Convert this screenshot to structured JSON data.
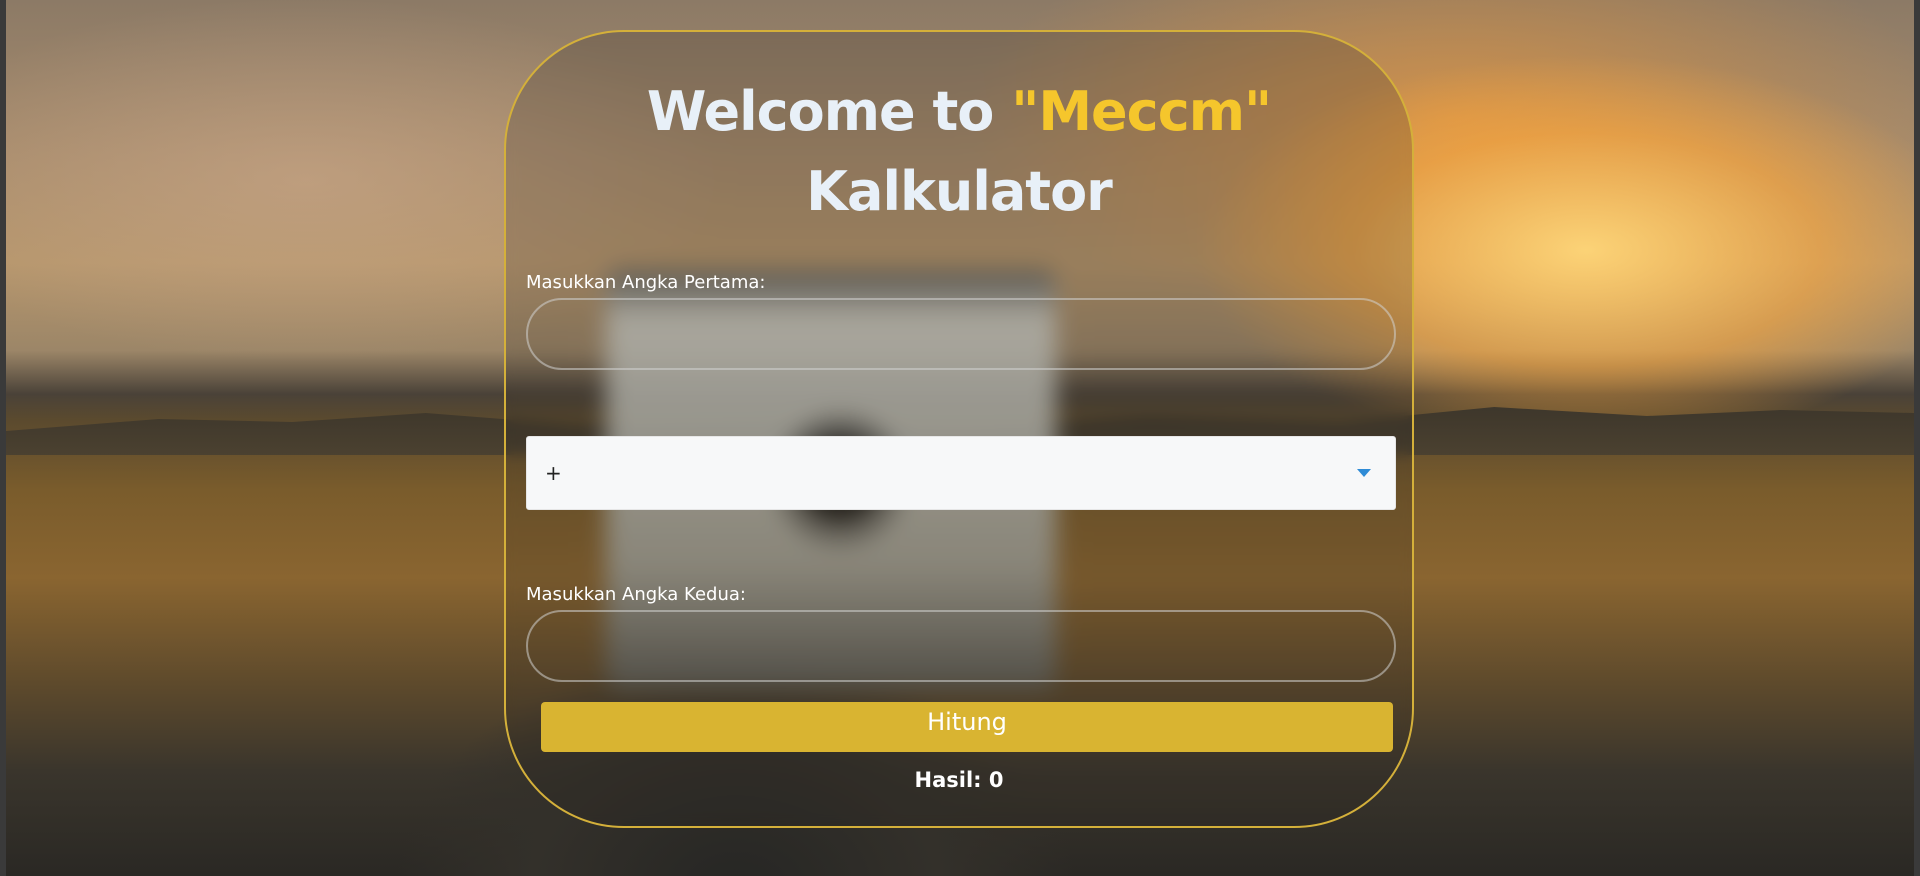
{
  "header": {
    "title_prefix": "Welcome to ",
    "title_brand": "\"Meccm\"",
    "title_suffix": "Kalkulator"
  },
  "form": {
    "first_label": "Masukkan Angka Pertama:",
    "first_value": "",
    "operator_value": "+",
    "second_label": "Masukkan Angka Kedua:",
    "second_value": "",
    "submit_label": "Hitung"
  },
  "result": {
    "text": "Hasil: 0"
  },
  "colors": {
    "accent": "#d9b431",
    "brand": "#f5c62c",
    "caret": "#2e8bd6"
  },
  "icons": {
    "operator_dropdown": "caret-down-icon"
  }
}
